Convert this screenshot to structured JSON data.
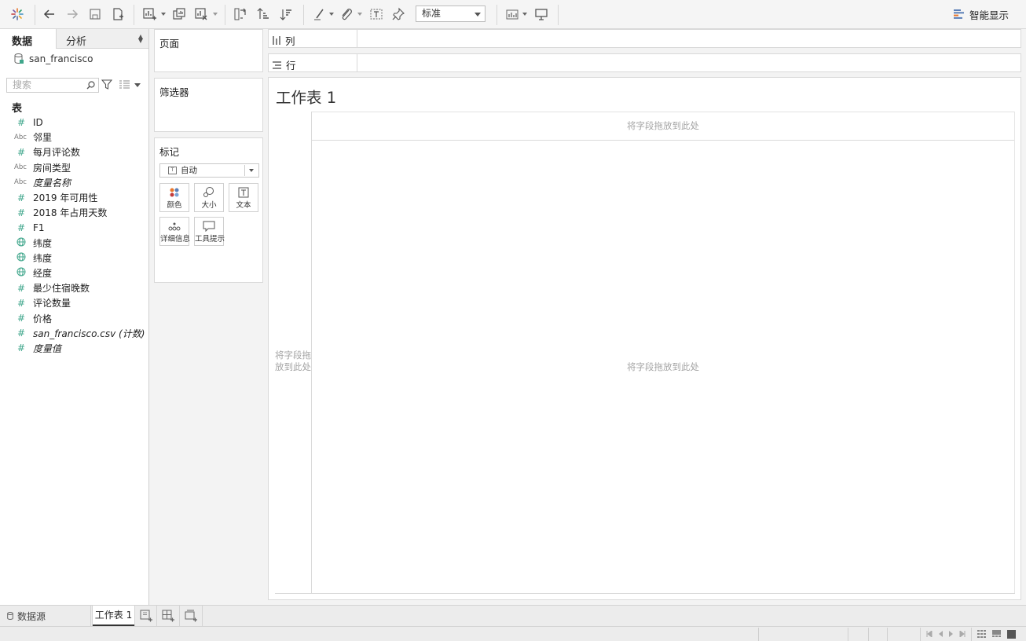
{
  "toolbar": {
    "standard_label": "标准",
    "smart_show_label": "智能显示",
    "icons": [
      "tableau-logo-icon",
      "undo-icon",
      "redo-icon",
      "save-icon",
      "add-datasource-icon",
      "new-worksheet-icon",
      "duplicate-icon",
      "clear-sheet-icon",
      "swap-icon",
      "sort-ascending-icon",
      "sort-descending-icon",
      "highlight-icon",
      "group-icon",
      "labels-icon",
      "pin-icon",
      "show-cards-icon",
      "presentation-icon",
      "smart-show-icon"
    ]
  },
  "left_pane": {
    "tab_data": "数据",
    "tab_analysis": "分析",
    "datasource_name": "san_francisco",
    "search_placeholder": "搜索",
    "table_header": "表",
    "fields": [
      {
        "type": "#",
        "kind": "number",
        "name": "ID",
        "italic": false
      },
      {
        "type": "Abc",
        "kind": "string",
        "name": "邻里",
        "italic": false
      },
      {
        "type": "#",
        "kind": "number",
        "name": "每月评论数",
        "italic": false
      },
      {
        "type": "Abc",
        "kind": "string",
        "name": "房间类型",
        "italic": false
      },
      {
        "type": "Abc",
        "kind": "string",
        "name": "度量名称",
        "italic": true
      },
      {
        "type": "#",
        "kind": "number",
        "name": "2019 年可用性",
        "italic": false
      },
      {
        "type": "#",
        "kind": "number",
        "name": "2018 年占用天数",
        "italic": false
      },
      {
        "type": "#",
        "kind": "number",
        "name": "F1",
        "italic": false
      },
      {
        "type": "globe",
        "kind": "geo",
        "name": "纬度",
        "italic": false
      },
      {
        "type": "globe",
        "kind": "geo",
        "name": "纬度",
        "italic": false
      },
      {
        "type": "globe",
        "kind": "geo",
        "name": "经度",
        "italic": false
      },
      {
        "type": "#",
        "kind": "number",
        "name": "最少住宿晚数",
        "italic": false
      },
      {
        "type": "#",
        "kind": "number",
        "name": "评论数量",
        "italic": false
      },
      {
        "type": "#",
        "kind": "number",
        "name": "价格",
        "italic": false
      },
      {
        "type": "#",
        "kind": "number",
        "name": "san_francisco.csv (计数)",
        "italic": true
      },
      {
        "type": "#",
        "kind": "number",
        "name": "度量值",
        "italic": true
      }
    ]
  },
  "cards": {
    "pages_title": "页面",
    "filters_title": "筛选器",
    "marks_title": "标记",
    "mark_type": "自动",
    "mark_buttons": [
      "颜色",
      "大小",
      "文本",
      "详细信息",
      "工具提示"
    ]
  },
  "shelves": {
    "columns_label": "列",
    "rows_label": "行"
  },
  "sheet": {
    "title": "工作表 1",
    "drop_columns": "将字段拖放到此处",
    "drop_rows": "将字段拖放到此处",
    "drop_center": "将字段拖放到此处"
  },
  "tabs_bar": {
    "datasource_tab": "数据源",
    "sheet_tab": "工作表 1"
  },
  "colors": {
    "number_icon": "#3fa68b",
    "accent": "#e8762c",
    "drop_text": "#a4a4a4"
  }
}
